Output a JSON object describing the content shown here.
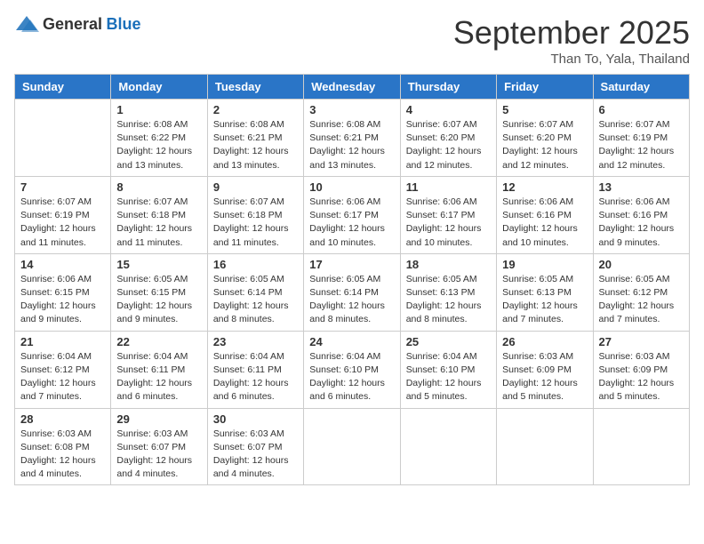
{
  "header": {
    "logo_general": "General",
    "logo_blue": "Blue",
    "month_title": "September 2025",
    "subtitle": "Than To, Yala, Thailand"
  },
  "days_of_week": [
    "Sunday",
    "Monday",
    "Tuesday",
    "Wednesday",
    "Thursday",
    "Friday",
    "Saturday"
  ],
  "weeks": [
    [
      null,
      {
        "day": "1",
        "sunrise": "6:08 AM",
        "sunset": "6:22 PM",
        "daylight": "12 hours and 13 minutes."
      },
      {
        "day": "2",
        "sunrise": "6:08 AM",
        "sunset": "6:21 PM",
        "daylight": "12 hours and 13 minutes."
      },
      {
        "day": "3",
        "sunrise": "6:08 AM",
        "sunset": "6:21 PM",
        "daylight": "12 hours and 13 minutes."
      },
      {
        "day": "4",
        "sunrise": "6:07 AM",
        "sunset": "6:20 PM",
        "daylight": "12 hours and 12 minutes."
      },
      {
        "day": "5",
        "sunrise": "6:07 AM",
        "sunset": "6:20 PM",
        "daylight": "12 hours and 12 minutes."
      },
      {
        "day": "6",
        "sunrise": "6:07 AM",
        "sunset": "6:19 PM",
        "daylight": "12 hours and 12 minutes."
      }
    ],
    [
      {
        "day": "7",
        "sunrise": "6:07 AM",
        "sunset": "6:19 PM",
        "daylight": "12 hours and 11 minutes."
      },
      {
        "day": "8",
        "sunrise": "6:07 AM",
        "sunset": "6:18 PM",
        "daylight": "12 hours and 11 minutes."
      },
      {
        "day": "9",
        "sunrise": "6:07 AM",
        "sunset": "6:18 PM",
        "daylight": "12 hours and 11 minutes."
      },
      {
        "day": "10",
        "sunrise": "6:06 AM",
        "sunset": "6:17 PM",
        "daylight": "12 hours and 10 minutes."
      },
      {
        "day": "11",
        "sunrise": "6:06 AM",
        "sunset": "6:17 PM",
        "daylight": "12 hours and 10 minutes."
      },
      {
        "day": "12",
        "sunrise": "6:06 AM",
        "sunset": "6:16 PM",
        "daylight": "12 hours and 10 minutes."
      },
      {
        "day": "13",
        "sunrise": "6:06 AM",
        "sunset": "6:16 PM",
        "daylight": "12 hours and 9 minutes."
      }
    ],
    [
      {
        "day": "14",
        "sunrise": "6:06 AM",
        "sunset": "6:15 PM",
        "daylight": "12 hours and 9 minutes."
      },
      {
        "day": "15",
        "sunrise": "6:05 AM",
        "sunset": "6:15 PM",
        "daylight": "12 hours and 9 minutes."
      },
      {
        "day": "16",
        "sunrise": "6:05 AM",
        "sunset": "6:14 PM",
        "daylight": "12 hours and 8 minutes."
      },
      {
        "day": "17",
        "sunrise": "6:05 AM",
        "sunset": "6:14 PM",
        "daylight": "12 hours and 8 minutes."
      },
      {
        "day": "18",
        "sunrise": "6:05 AM",
        "sunset": "6:13 PM",
        "daylight": "12 hours and 8 minutes."
      },
      {
        "day": "19",
        "sunrise": "6:05 AM",
        "sunset": "6:13 PM",
        "daylight": "12 hours and 7 minutes."
      },
      {
        "day": "20",
        "sunrise": "6:05 AM",
        "sunset": "6:12 PM",
        "daylight": "12 hours and 7 minutes."
      }
    ],
    [
      {
        "day": "21",
        "sunrise": "6:04 AM",
        "sunset": "6:12 PM",
        "daylight": "12 hours and 7 minutes."
      },
      {
        "day": "22",
        "sunrise": "6:04 AM",
        "sunset": "6:11 PM",
        "daylight": "12 hours and 6 minutes."
      },
      {
        "day": "23",
        "sunrise": "6:04 AM",
        "sunset": "6:11 PM",
        "daylight": "12 hours and 6 minutes."
      },
      {
        "day": "24",
        "sunrise": "6:04 AM",
        "sunset": "6:10 PM",
        "daylight": "12 hours and 6 minutes."
      },
      {
        "day": "25",
        "sunrise": "6:04 AM",
        "sunset": "6:10 PM",
        "daylight": "12 hours and 5 minutes."
      },
      {
        "day": "26",
        "sunrise": "6:03 AM",
        "sunset": "6:09 PM",
        "daylight": "12 hours and 5 minutes."
      },
      {
        "day": "27",
        "sunrise": "6:03 AM",
        "sunset": "6:09 PM",
        "daylight": "12 hours and 5 minutes."
      }
    ],
    [
      {
        "day": "28",
        "sunrise": "6:03 AM",
        "sunset": "6:08 PM",
        "daylight": "12 hours and 4 minutes."
      },
      {
        "day": "29",
        "sunrise": "6:03 AM",
        "sunset": "6:07 PM",
        "daylight": "12 hours and 4 minutes."
      },
      {
        "day": "30",
        "sunrise": "6:03 AM",
        "sunset": "6:07 PM",
        "daylight": "12 hours and 4 minutes."
      },
      null,
      null,
      null,
      null
    ]
  ]
}
